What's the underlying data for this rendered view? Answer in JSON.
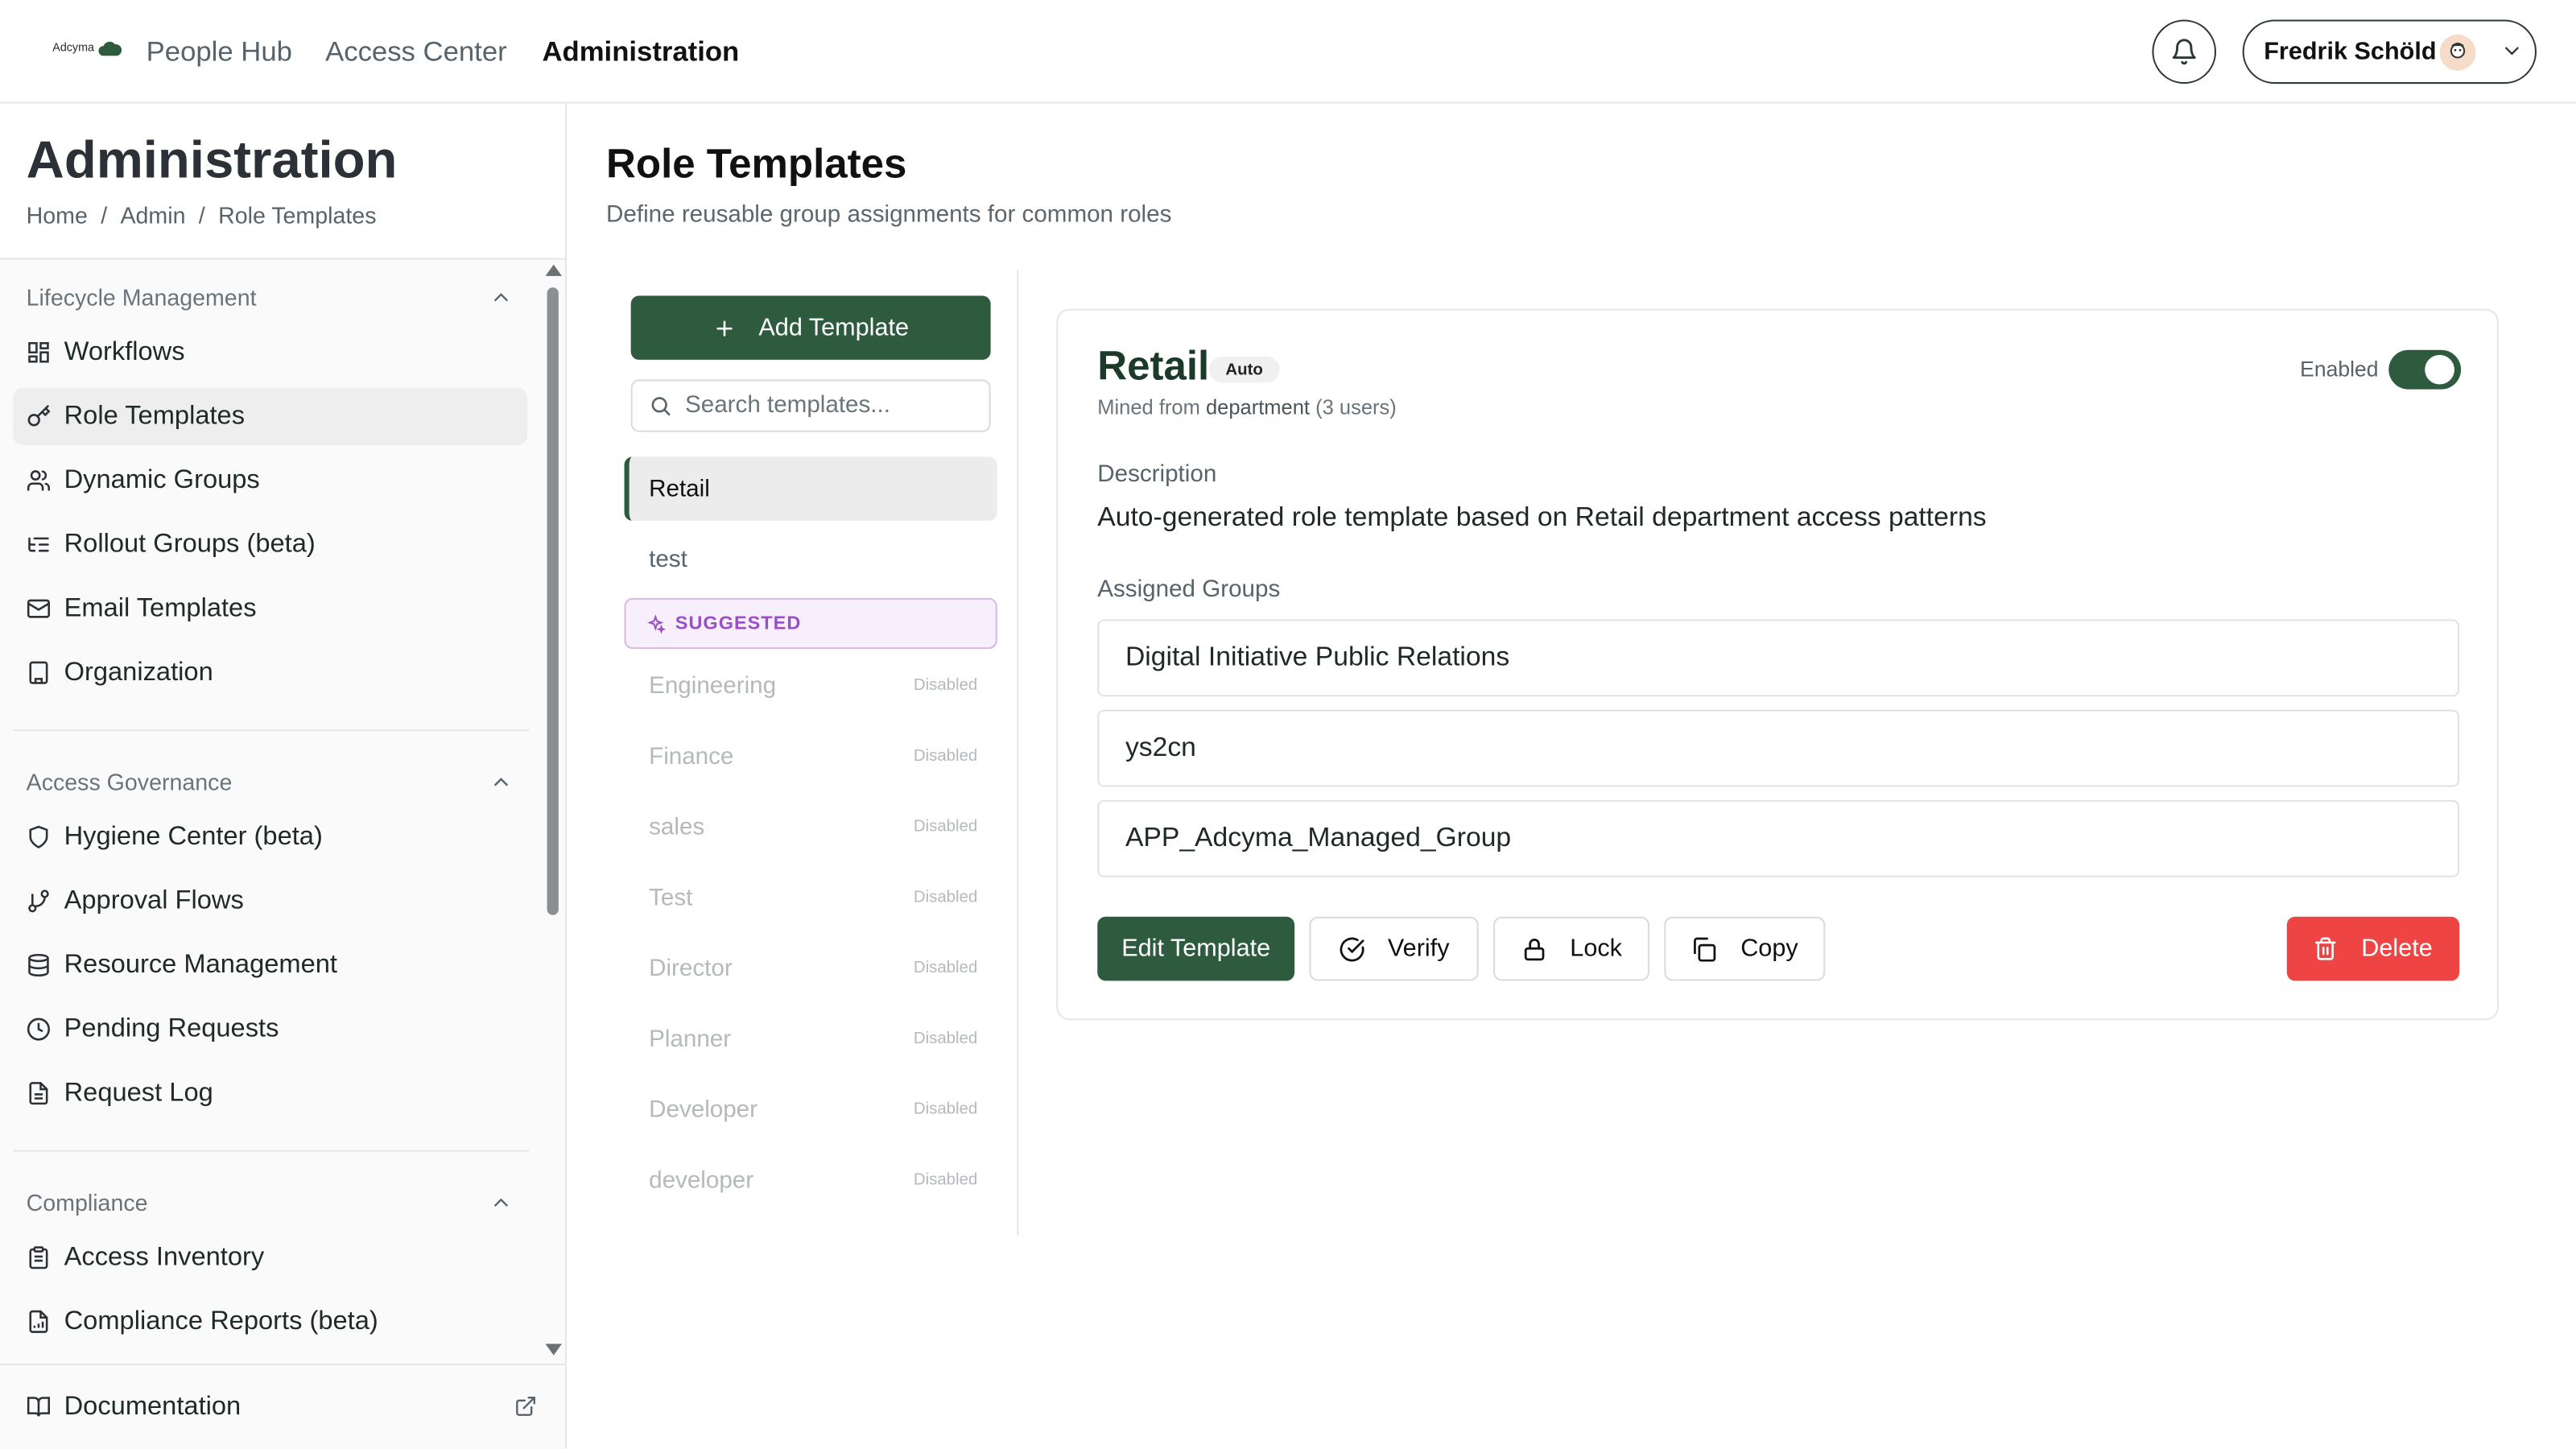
{
  "header": {
    "logo_text": "Adcyma",
    "nav": [
      "People Hub",
      "Access Center",
      "Administration"
    ],
    "user_name": "Fredrik Schöld"
  },
  "sidebar": {
    "title": "Administration",
    "breadcrumb": [
      "Home",
      "/",
      "Admin",
      "/",
      "Role Templates"
    ],
    "sections": [
      {
        "label": "Lifecycle Management",
        "items": [
          {
            "label": "Workflows",
            "icon": "grid-icon"
          },
          {
            "label": "Role Templates",
            "icon": "key-icon",
            "active": true
          },
          {
            "label": "Dynamic Groups",
            "icon": "users-icon"
          },
          {
            "label": "Rollout Groups (beta)",
            "icon": "list-tree-icon"
          },
          {
            "label": "Email Templates",
            "icon": "mail-icon"
          },
          {
            "label": "Organization",
            "icon": "building-icon"
          }
        ]
      },
      {
        "label": "Access Governance",
        "items": [
          {
            "label": "Hygiene Center (beta)",
            "icon": "shield-icon"
          },
          {
            "label": "Approval Flows",
            "icon": "git-branch-icon"
          },
          {
            "label": "Resource Management",
            "icon": "database-icon"
          },
          {
            "label": "Pending Requests",
            "icon": "clock-icon"
          },
          {
            "label": "Request Log",
            "icon": "file-text-icon"
          }
        ]
      },
      {
        "label": "Compliance",
        "items": [
          {
            "label": "Access Inventory",
            "icon": "clipboard-icon"
          },
          {
            "label": "Compliance Reports (beta)",
            "icon": "file-chart-icon"
          }
        ]
      }
    ],
    "footer": {
      "label": "Documentation",
      "icon": "book-icon"
    }
  },
  "main": {
    "title": "Role Templates",
    "subtitle": "Define reusable group assignments for common roles",
    "add_button": "Add Template",
    "search_placeholder": "Search templates...",
    "templates": [
      {
        "name": "Retail",
        "active": true
      },
      {
        "name": "test"
      }
    ],
    "suggested_label": "SUGGESTED",
    "suggested": [
      {
        "name": "Engineering",
        "status": "Disabled"
      },
      {
        "name": "Finance",
        "status": "Disabled"
      },
      {
        "name": "sales",
        "status": "Disabled"
      },
      {
        "name": "Test",
        "status": "Disabled"
      },
      {
        "name": "Director",
        "status": "Disabled"
      },
      {
        "name": "Planner",
        "status": "Disabled"
      },
      {
        "name": "Developer",
        "status": "Disabled"
      },
      {
        "name": "developer",
        "status": "Disabled"
      }
    ]
  },
  "detail": {
    "name": "Retail",
    "badge": "Auto",
    "mined_prefix": "Mined from",
    "mined_source": "department",
    "mined_count": "(3 users)",
    "enabled_label": "Enabled",
    "enabled": true,
    "description_label": "Description",
    "description": "Auto-generated role template based on Retail department access patterns",
    "groups_label": "Assigned Groups",
    "groups": [
      "Digital Initiative Public Relations",
      "ys2cn",
      "APP_Adcyma_Managed_Group"
    ],
    "actions": {
      "edit": "Edit Template",
      "verify": "Verify",
      "lock": "Lock",
      "copy": "Copy",
      "delete": "Delete"
    }
  },
  "colors": {
    "brand": "#2e5a3e",
    "danger": "#ef4444",
    "suggested": "#9b4fc6"
  }
}
